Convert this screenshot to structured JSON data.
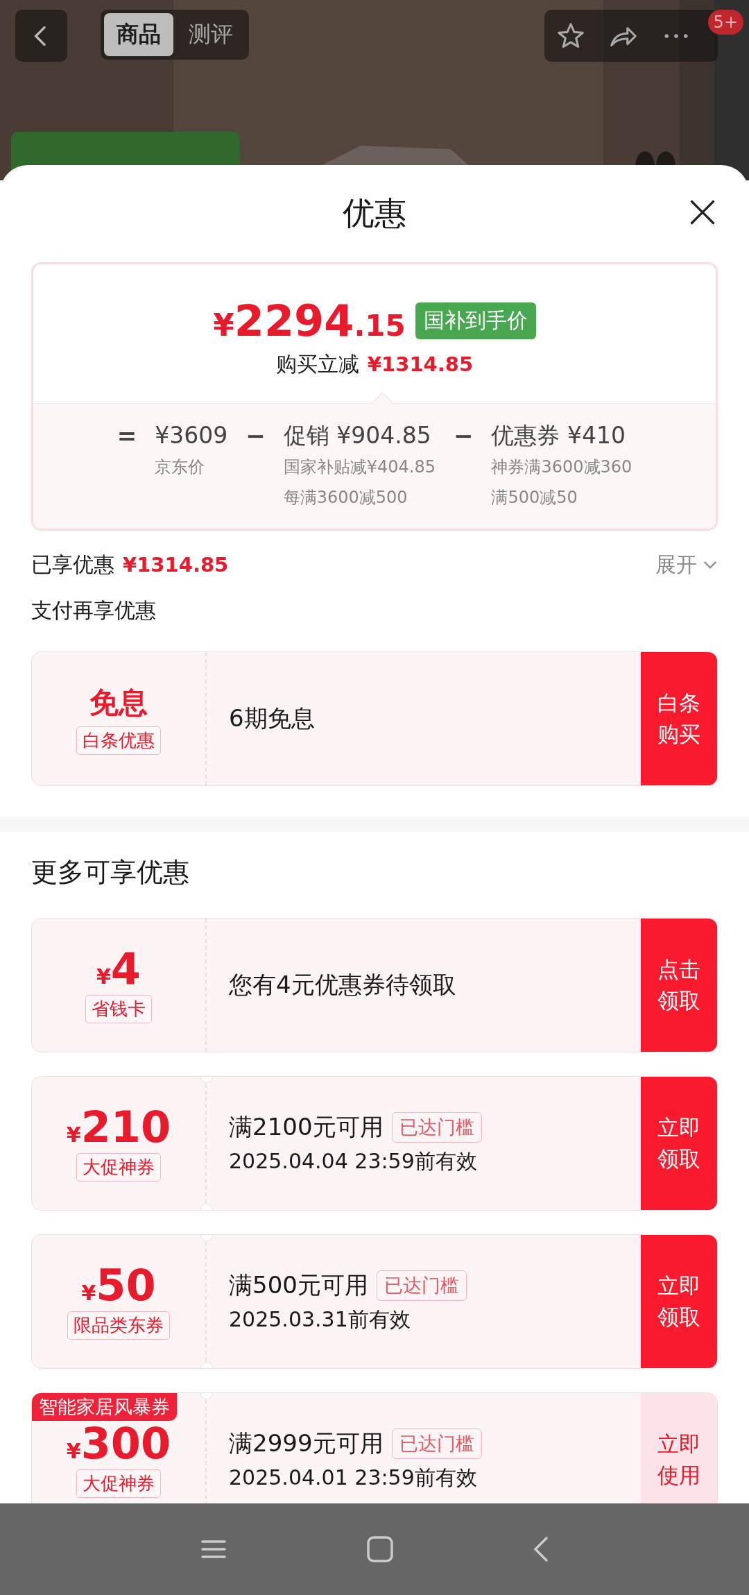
{
  "header": {
    "tabs": [
      {
        "label": "商品",
        "selected": true
      },
      {
        "label": "测评",
        "selected": false
      }
    ],
    "badge": "5+"
  },
  "sheet": {
    "title": "优惠"
  },
  "price_card": {
    "currency": "¥",
    "integer": "2294",
    "decimal": ".15",
    "badge": "国补到手价",
    "saving_label": "购买立减",
    "saving_amount": "¥1314.85",
    "breakdown": [
      {
        "operator": "=",
        "amount": "¥3609",
        "details": [
          "京东价"
        ]
      },
      {
        "operator": "−",
        "amount": "促销 ¥904.85",
        "details": [
          "国家补贴减¥404.85",
          "每满3600减500"
        ]
      },
      {
        "operator": "−",
        "amount": "优惠券 ¥410",
        "details": [
          "神券满3600减360",
          "满500减50"
        ]
      }
    ]
  },
  "enjoyed": {
    "label": "已享优惠",
    "amount": "¥1314.85",
    "toggle": "展开"
  },
  "payment": {
    "heading": "支付再享优惠",
    "offer": {
      "kind": "text",
      "value": "免息",
      "tag": "白条优惠",
      "title": "6期免息",
      "action": "白条购买",
      "claimed": false
    }
  },
  "more": {
    "heading": "更多可享优惠",
    "coupons": [
      {
        "kind": "amount",
        "currency": "¥",
        "value": "4",
        "tag": "省钱卡",
        "title": "您有4元优惠券待领取",
        "action": "点击领取",
        "claimed": false
      },
      {
        "kind": "amount",
        "currency": "¥",
        "value": "210",
        "tag": "大促神券",
        "title": "满2100元可用",
        "threshold": "已达门槛",
        "validity": "2025.04.04 23:59前有效",
        "action": "立即领取",
        "claimed": false
      },
      {
        "kind": "amount",
        "currency": "¥",
        "value": "50",
        "tag": "限品类东券",
        "title": "满500元可用",
        "threshold": "已达门槛",
        "validity": "2025.03.31前有效",
        "action": "立即领取",
        "claimed": false
      },
      {
        "kind": "amount",
        "corner_tag": "智能家居风暴券",
        "currency": "¥",
        "value": "300",
        "tag": "大促神券",
        "title": "满2999元可用",
        "threshold": "已达门槛",
        "validity": "2025.04.01 23:59前有效",
        "action": "立即使用",
        "claimed": true
      }
    ]
  }
}
